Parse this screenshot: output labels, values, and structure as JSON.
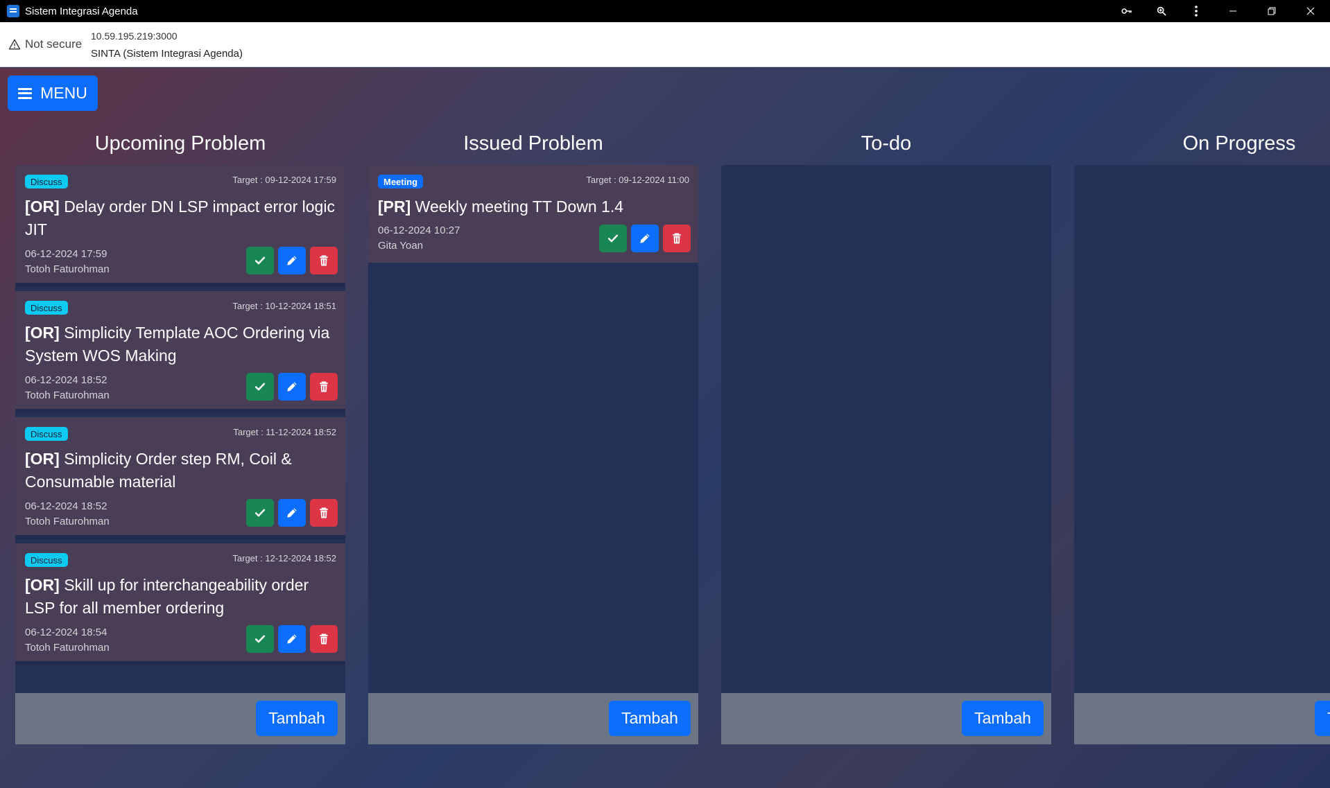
{
  "window": {
    "title": "Sistem Integrasi Agenda",
    "icons": [
      "key-icon",
      "zoom-icon",
      "more-vert-icon"
    ],
    "controls": [
      "minimize-icon",
      "restore-icon",
      "close-icon"
    ]
  },
  "address": {
    "security": "Not secure",
    "url": "10.59.195.219:3000",
    "page_title": "SINTA (Sistem Integrasi Agenda)"
  },
  "colors": {
    "primary": "#0d6efd",
    "success": "#198754",
    "danger": "#dc3545",
    "info": "#0dcaf0",
    "column_bg": "#243056",
    "card_bg": "#4a3d56",
    "footer_bg": "#6c7585"
  },
  "menu_label": "MENU",
  "columns": [
    {
      "title": "Upcoming Problem",
      "add_label": "Tambah",
      "cards": [
        {
          "badge": "Discuss",
          "target": "Target : 09-12-2024 17:59",
          "tag": "[OR]",
          "text": "Delay order DN LSP impact error logic JIT",
          "date": "06-12-2024 17:59",
          "author": "Totoh Faturohman"
        },
        {
          "badge": "Discuss",
          "target": "Target : 10-12-2024 18:51",
          "tag": "[OR]",
          "text": "Simplicity Template AOC Ordering via System WOS Making",
          "date": "06-12-2024 18:52",
          "author": "Totoh Faturohman"
        },
        {
          "badge": "Discuss",
          "target": "Target : 11-12-2024 18:52",
          "tag": "[OR]",
          "text": "Simplicity Order step RM, Coil & Consumable material",
          "date": "06-12-2024 18:52",
          "author": "Totoh Faturohman"
        },
        {
          "badge": "Discuss",
          "target": "Target : 12-12-2024 18:52",
          "tag": "[OR]",
          "text": "Skill up for interchangeability order LSP for all member ordering",
          "date": "06-12-2024 18:54",
          "author": "Totoh Faturohman"
        }
      ]
    },
    {
      "title": "Issued Problem",
      "add_label": "Tambah",
      "cards": [
        {
          "badge": "Meeting",
          "target": "Target : 09-12-2024 11:00",
          "tag": "[PR]",
          "text": "Weekly meeting TT Down 1.4",
          "date": "06-12-2024 10:27",
          "author": "Gita Yoan"
        }
      ]
    },
    {
      "title": "To-do",
      "add_label": "Tambah",
      "cards": []
    },
    {
      "title": "On Progress",
      "add_label": "Tambah",
      "cards": []
    }
  ]
}
